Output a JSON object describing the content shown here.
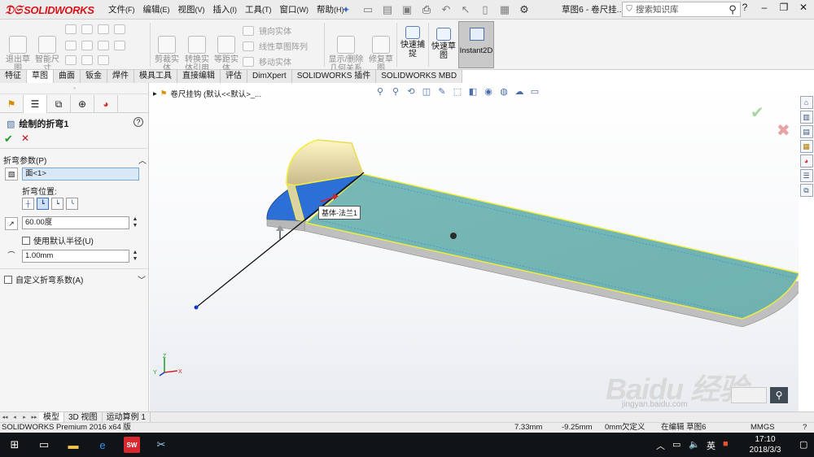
{
  "app": {
    "logo_text": "SOLIDWORKS",
    "title": "草图6 - 卷尺挂...",
    "search_placeholder": "搜索知识库"
  },
  "menus": [
    {
      "label": "文件",
      "key": "(F)"
    },
    {
      "label": "编辑",
      "key": "(E)"
    },
    {
      "label": "视图",
      "key": "(V)"
    },
    {
      "label": "插入",
      "key": "(I)"
    },
    {
      "label": "工具",
      "key": "(T)"
    },
    {
      "label": "窗口",
      "key": "(W)"
    },
    {
      "label": "帮助",
      "key": "(H)"
    }
  ],
  "commands": {
    "exit_sketch": "退出草图",
    "smart_dim": "智能尺寸",
    "trim": "剪裁实体",
    "convert": "转换实体引用",
    "offset": "等距实体",
    "mirror": "镜向实体",
    "linear_pattern": "线性草图阵列",
    "move": "移动实体",
    "show_relations": "显示/删除几何关系",
    "repair": "修复草图",
    "quick_snap": "快速捕捉",
    "rapid_sketch": "快速草图",
    "instant2d": "Instant2D"
  },
  "tabs": [
    "特征",
    "草图",
    "曲面",
    "钣金",
    "焊件",
    "模具工具",
    "直接编辑",
    "评估",
    "DimXpert",
    "SOLIDWORKS 插件",
    "SOLIDWORKS MBD"
  ],
  "selected_tab": "草图",
  "property_manager": {
    "title": "绘制的折弯1",
    "bend_params_header": "折弯参数(P)",
    "face_value": "面<1>",
    "bend_position_label": "折弯位置:",
    "angle_value": "60.00度",
    "default_radius_label": "使用默认半径(U)",
    "radius_value": "1.00mm",
    "custom_allowance_label": "自定义折弯系数(A)"
  },
  "viewport": {
    "tree_path": "卷尺挂钩  (默认<<默认>_...",
    "tooltip": "基体-法兰1"
  },
  "bottom_tabs": [
    "模型",
    "3D 视图",
    "运动算例 1"
  ],
  "status": {
    "product": "SOLIDWORKS Premium 2016 x64 版",
    "x": "7.33mm",
    "y": "-9.25mm",
    "z": "0mm",
    "state": "欠定义",
    "editing": "在编辑 草图6",
    "units": "MMGS"
  },
  "watermark": {
    "text": "Baidu 经验",
    "url": "jingyan.baidu.com"
  },
  "taskbar": {
    "ime": "英",
    "time": "17:10",
    "date": "2018/3/3"
  },
  "colors": {
    "brand": "#d8141a",
    "face_fill": "#6fb2b0",
    "highlight": "#f2ee3a",
    "selected_face": "#2c6fd6"
  }
}
